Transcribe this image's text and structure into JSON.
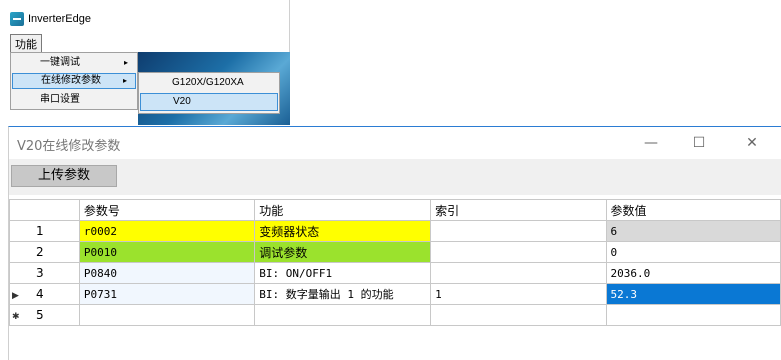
{
  "app": {
    "title": "InverterEdge",
    "menu_label": "功能"
  },
  "dropdown": {
    "items": [
      {
        "label": "一键调试",
        "has_submenu": true,
        "arrow": "▸"
      },
      {
        "label": "在线修改参数",
        "has_submenu": true,
        "arrow": "▸"
      },
      {
        "label": "串口设置",
        "has_submenu": false,
        "arrow": ""
      }
    ]
  },
  "submenu": {
    "items": [
      {
        "label": "G120X/G120XA"
      },
      {
        "label": "V20"
      }
    ]
  },
  "dialog": {
    "title": "V20在线修改参数",
    "minimize": "—",
    "maximize": "☐",
    "close": "✕",
    "upload_button": "上传参数"
  },
  "grid": {
    "headers": [
      "",
      "参数号",
      "功能",
      "索引",
      "参数值"
    ],
    "rows": [
      {
        "marker": "",
        "num": "1",
        "param": "r0002",
        "func": "变频器状态",
        "index": "",
        "value": "6"
      },
      {
        "marker": "",
        "num": "2",
        "param": "P0010",
        "func": "调试参数",
        "index": "",
        "value": "0"
      },
      {
        "marker": "",
        "num": "3",
        "param": "P0840",
        "func": "BI: ON/OFF1",
        "index": "",
        "value": "2036.0"
      },
      {
        "marker": "▶",
        "num": "4",
        "param": "P0731",
        "func": "BI: 数字量输出 1 的功能",
        "index": "1",
        "value": "52.3"
      },
      {
        "marker": "✱",
        "num": "5",
        "param": "",
        "func": "",
        "index": "",
        "value": ""
      }
    ]
  },
  "colors": {
    "param_yellow": "#ffff00",
    "param_green": "#9be22d",
    "selection_blue": "#0a78d4",
    "readonly_gray": "#d9d9d9"
  }
}
